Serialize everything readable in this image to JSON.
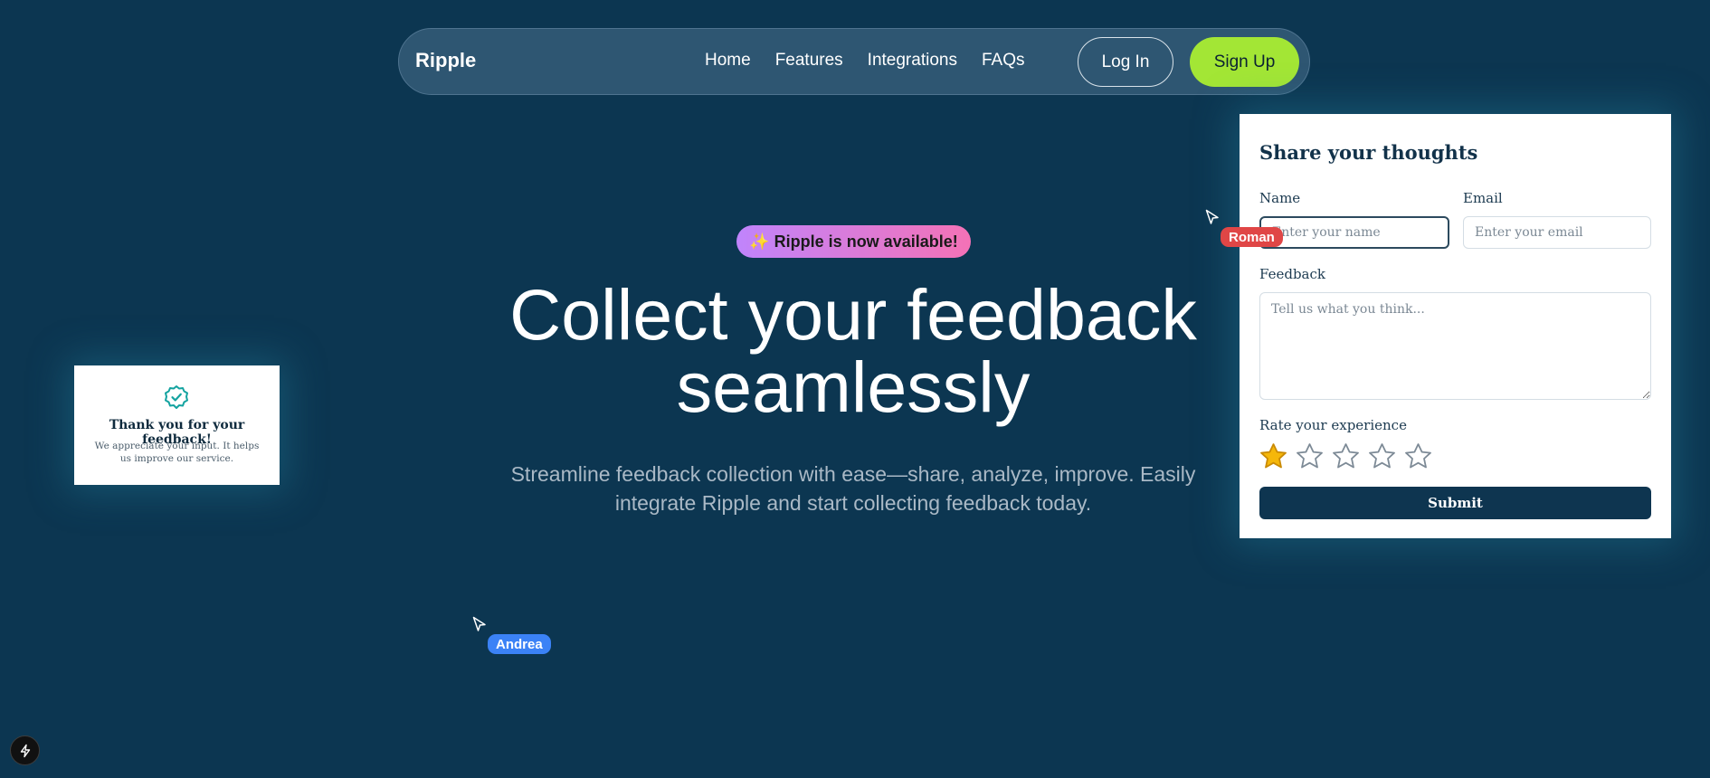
{
  "nav": {
    "brand": "Ripple",
    "links": [
      "Home",
      "Features",
      "Integrations",
      "FAQs"
    ],
    "login_label": "Log In",
    "signup_label": "Sign Up"
  },
  "hero": {
    "badge": "✨ Ripple is now available!",
    "title_line1": "Collect your feedback",
    "title_line2": "seamlessly",
    "subtitle_line1": "Streamline feedback collection with ease—share, analyze, improve. Easily",
    "subtitle_line2": "integrate Ripple and start collecting feedback today."
  },
  "thanks_card": {
    "icon": "check-badge-icon",
    "title": "Thank you for your feedback!",
    "text": "We appreciate your input. It helps us improve our service."
  },
  "form": {
    "title": "Share your thoughts",
    "name_label": "Name",
    "name_placeholder": "Enter your name",
    "email_label": "Email",
    "email_placeholder": "Enter your email",
    "feedback_label": "Feedback",
    "feedback_placeholder": "Tell us what you think...",
    "rating_label": "Rate your experience",
    "rating": 1,
    "rating_max": 5,
    "submit_label": "Submit"
  },
  "cursors": {
    "roman": "Roman",
    "andrea": "Andrea"
  },
  "colors": {
    "background": "#0c3651",
    "accent_green": "#a3e635",
    "star_filled": "#f5b70a",
    "submit_bg": "#0e3550",
    "roman_tag": "#e04646",
    "andrea_tag": "#3b82f6"
  }
}
